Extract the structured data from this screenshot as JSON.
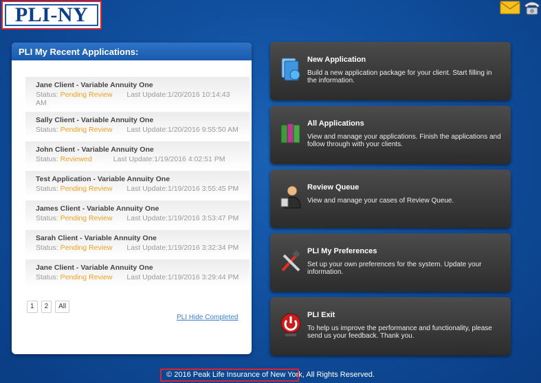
{
  "logo": {
    "text": "PLI-NY"
  },
  "top_icons": [
    "mail-icon",
    "phone-icon"
  ],
  "recent": {
    "title": "PLI My Recent Applications:",
    "status_label": "Status:",
    "items": [
      {
        "name": "Jane Client - Variable Annuity One",
        "status": "Pending Review",
        "update": "Last Update:1/20/2016 10:14:43 AM"
      },
      {
        "name": "Sally Client - Variable Annuity One",
        "status": "Pending Review",
        "update": "Last Update:1/20/2016 9:55:50 AM"
      },
      {
        "name": "John Client - Variable Annuity One",
        "status": "Reviewed",
        "update": "Last Update:1/19/2016 4:02:51 PM"
      },
      {
        "name": "Test Application - Variable Annuity One",
        "status": "Pending Review",
        "update": "Last Update:1/19/2016 3:55:45 PM"
      },
      {
        "name": "James Client - Variable Annuity One",
        "status": "Pending Review",
        "update": "Last Update:1/19/2016 3:53:47 PM"
      },
      {
        "name": "Sarah Client - Variable Annuity One",
        "status": "Pending Review",
        "update": "Last Update:1/19/2016 3:32:34 PM"
      },
      {
        "name": "Jane Client - Variable Annuity One",
        "status": "Pending Review",
        "update": "Last Update:1/19/2016 3:29:44 PM"
      }
    ],
    "pages": [
      "1",
      "2",
      "All"
    ],
    "hide_completed": "PLI Hide Completed"
  },
  "tiles": [
    {
      "title": "New Application",
      "desc": "Build a new application package for your client. Start filling in the information.",
      "icon": "new-application-icon"
    },
    {
      "title": "All Applications",
      "desc": "View and manage your applications. Finish the applications and follow through with your clients.",
      "icon": "binders-icon"
    },
    {
      "title": "Review Queue",
      "desc": "View and manage your cases of Review Queue.",
      "icon": "reviewer-icon"
    },
    {
      "title": "PLI My Preferences",
      "desc": "Set up your own preferences for the system. Update your information.",
      "icon": "tools-icon"
    },
    {
      "title": "PLI Exit",
      "desc": "To help us improve the performance and functionality, please send us your feedback. Thank you.",
      "icon": "power-icon"
    }
  ],
  "footer": {
    "text": "© 2016 Peak Life Insurance of New York, All Rights Reserved."
  },
  "colors": {
    "background": "#0f4c9a",
    "header": "#1a5aab",
    "status_pending": "#f0a020",
    "tile": "#3b3b3b",
    "highlight_box": "#e0202a"
  }
}
